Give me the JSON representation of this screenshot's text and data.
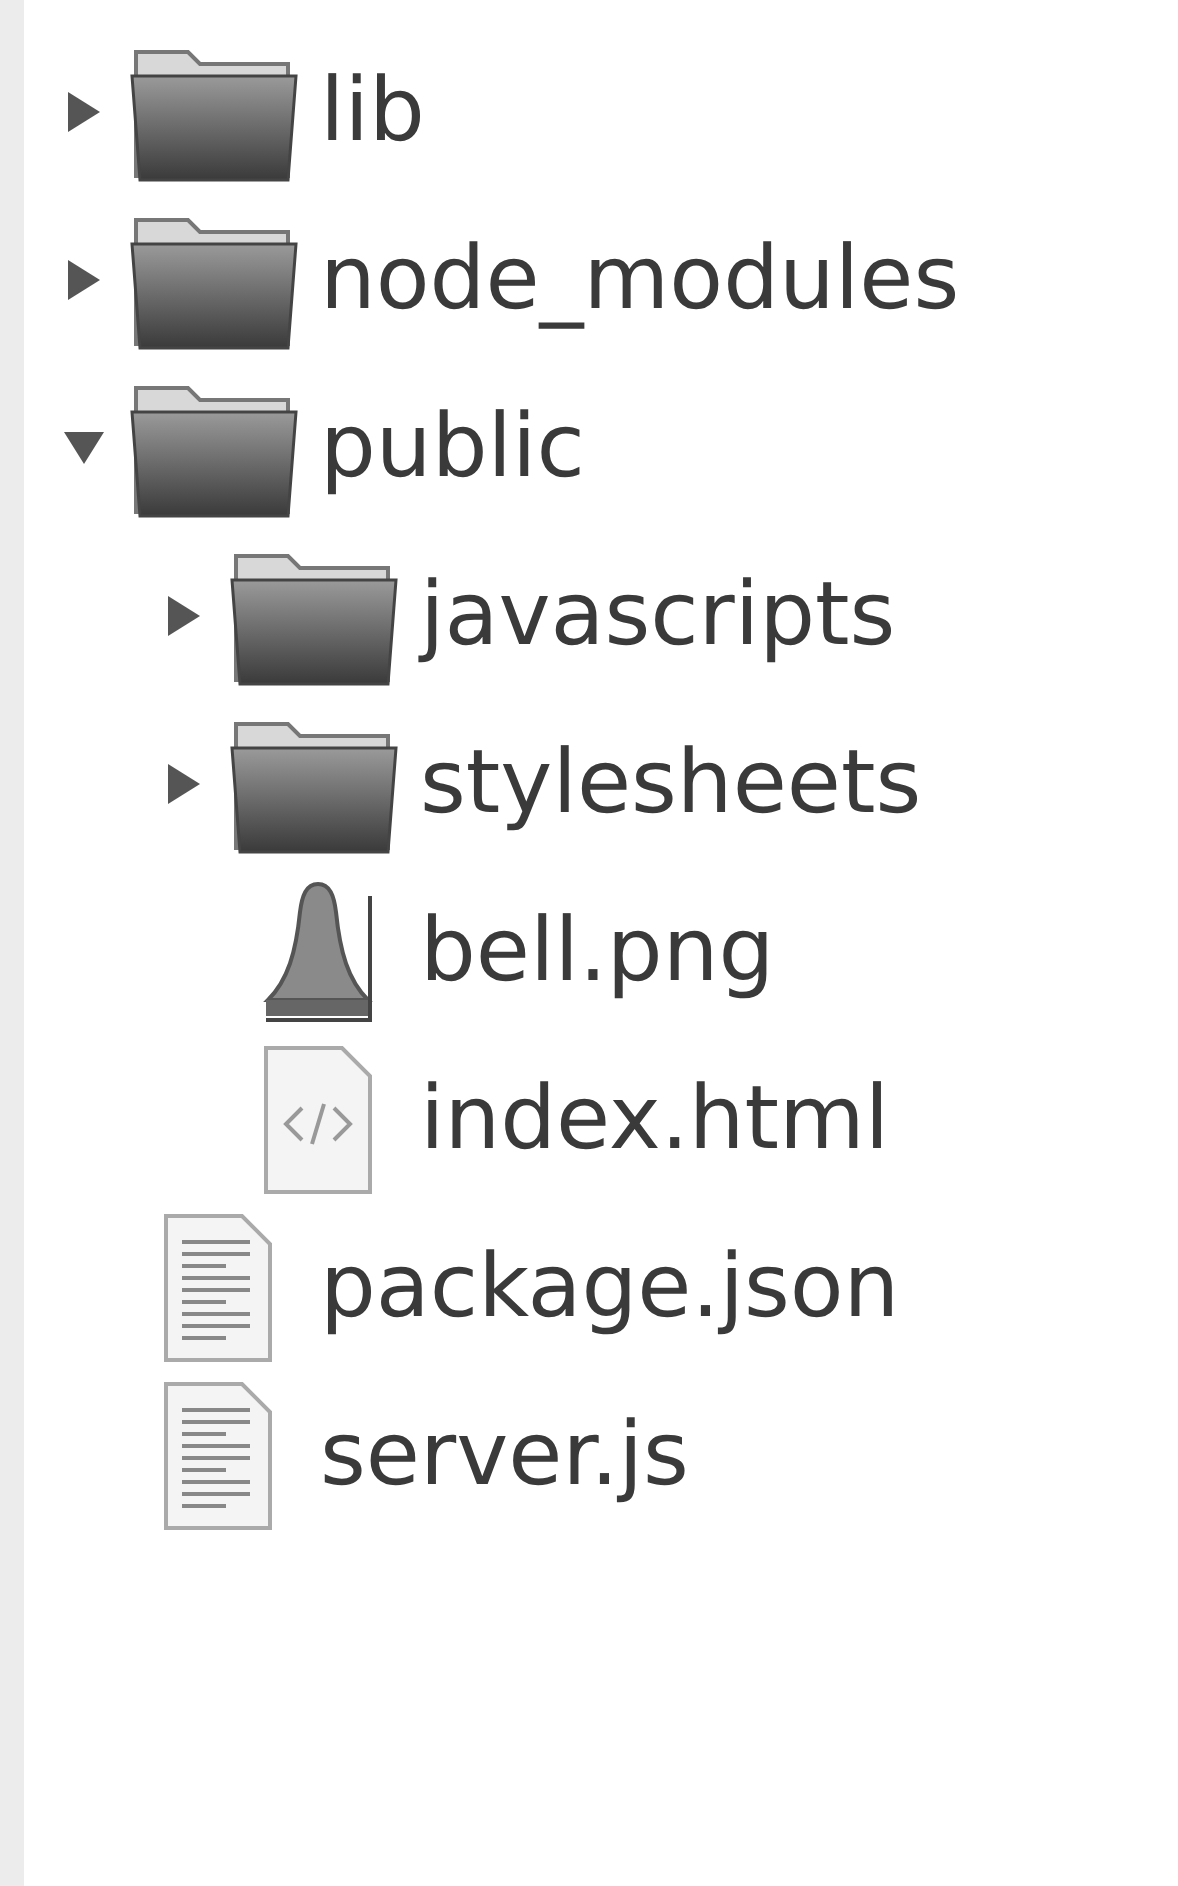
{
  "tree": [
    {
      "kind": "folder",
      "label": "lib",
      "expanded": false
    },
    {
      "kind": "folder",
      "label": "node_modules",
      "expanded": false
    },
    {
      "kind": "folder",
      "label": "public",
      "expanded": true,
      "children": [
        {
          "kind": "folder",
          "label": "javascripts",
          "expanded": false
        },
        {
          "kind": "folder",
          "label": "stylesheets",
          "expanded": false
        },
        {
          "kind": "image",
          "label": "bell.png"
        },
        {
          "kind": "html",
          "label": "index.html"
        }
      ]
    },
    {
      "kind": "text",
      "label": "package.json"
    },
    {
      "kind": "text",
      "label": "server.js"
    }
  ]
}
